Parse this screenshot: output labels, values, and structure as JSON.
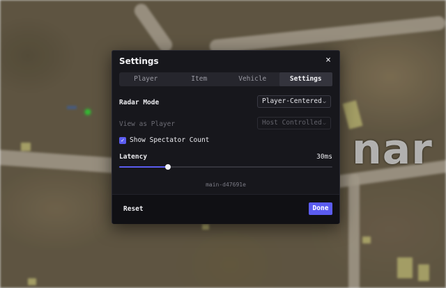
{
  "map": {
    "place_label": "nar"
  },
  "settings": {
    "title": "Settings",
    "close_glyph": "×",
    "tabs": [
      {
        "label": "Player",
        "active": false
      },
      {
        "label": "Item",
        "active": false
      },
      {
        "label": "Vehicle",
        "active": false
      },
      {
        "label": "Settings",
        "active": true
      }
    ],
    "radar_mode": {
      "label": "Radar Mode",
      "value": "Player-Centered",
      "enabled": true
    },
    "view_as_player": {
      "label": "View as Player",
      "value": "Host Controlled",
      "enabled": false
    },
    "show_spectator": {
      "label": "Show Spectator Count",
      "checked": true
    },
    "latency": {
      "label": "Latency",
      "value_text": "30ms",
      "fraction": 0.23
    },
    "build": "main-d47691e",
    "buttons": {
      "reset": "Reset",
      "done": "Done"
    },
    "colors": {
      "accent": "#5b5cf0",
      "panel": "#17171c",
      "footer": "#101014"
    },
    "icons": {
      "close": "close-icon",
      "chevron": "chevron-down-icon",
      "check": "check-icon"
    }
  }
}
